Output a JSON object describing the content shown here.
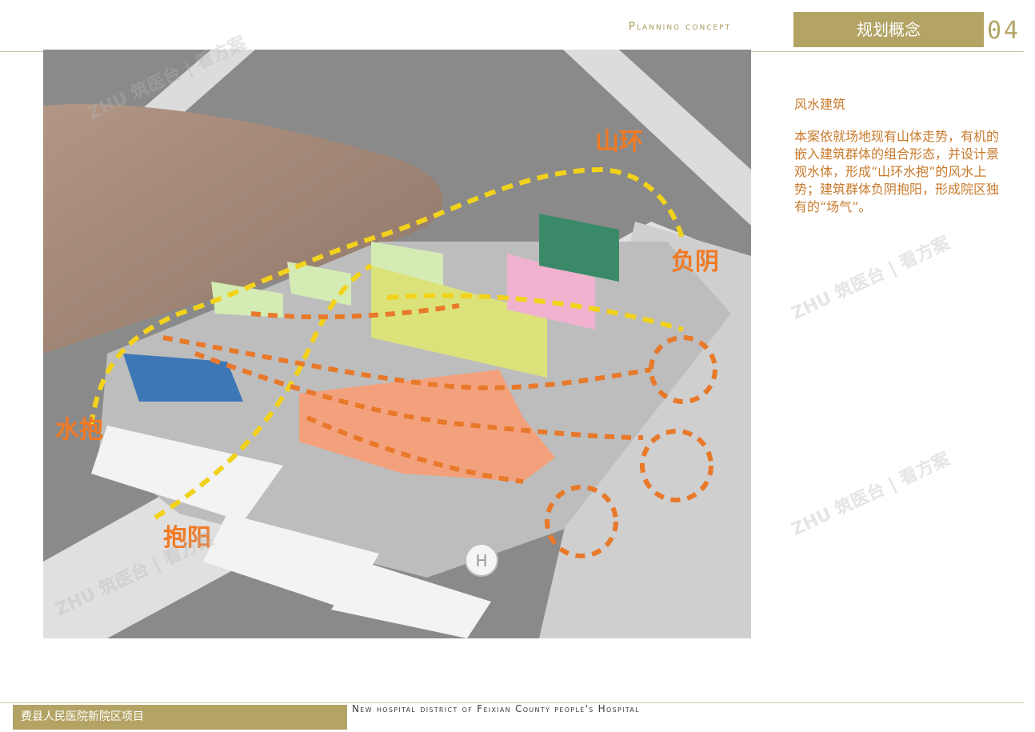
{
  "header": {
    "title_en": "Planning concept",
    "title_cn": "规划概念",
    "page_number": "04"
  },
  "map": {
    "labels": {
      "shanhuan": "山环",
      "fuyin": "负阴",
      "shuibao": "水抱",
      "baoyang": "抱阳",
      "helipad": "H"
    }
  },
  "side": {
    "title": "风水建筑",
    "body": "本案依就场地现有山体走势，有机的嵌入建筑群体的组合形态，并设计景观水体，形成“山环水抱”的风水上势；建筑群体负阴抱阳，形成院区独有的“场气”。"
  },
  "footer": {
    "project_cn": "费县人民医院新院区项目",
    "project_en": "New hospital district of Feixian County people's Hospital"
  },
  "watermark": "ZHU 筑医台 | 看方案",
  "colors": {
    "gold": "#b3a465",
    "accent_orange": "#e8792a",
    "accent_yellow": "#f2d21a"
  }
}
